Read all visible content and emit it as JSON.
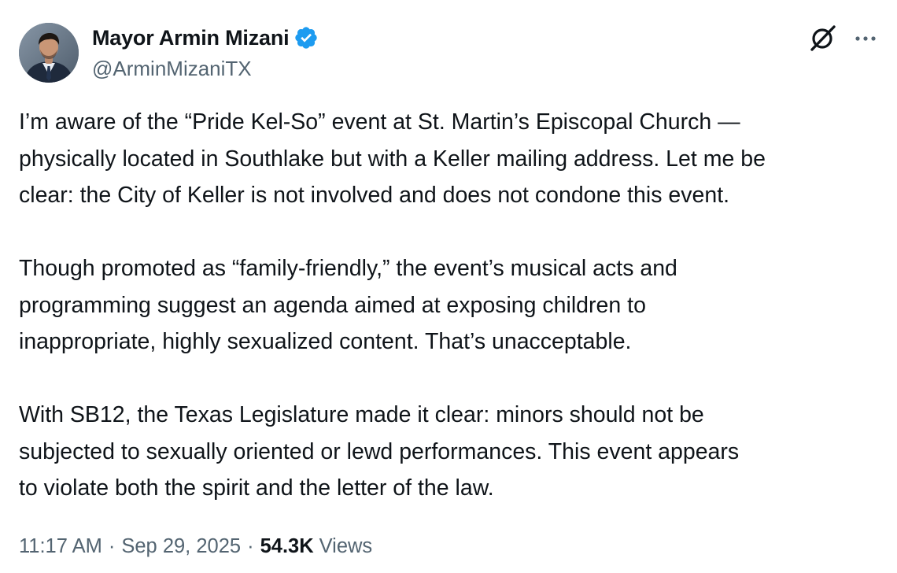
{
  "author": {
    "display_name": "Mayor Armin Mizani",
    "handle": "@ArminMizaniTX",
    "verified": true,
    "verified_color": "#1d9bf0",
    "avatar_icon": "profile-photo"
  },
  "actions": {
    "grok_icon": "grok-icon",
    "more_icon": "more-icon"
  },
  "tweet": {
    "paragraphs": [
      "I’m aware of the “Pride Kel-So” event at St. Martin’s Episcopal Church —\nphysically located in Southlake but with a Keller mailing address. Let me be\nclear: the City of Keller is not involved and does not condone this event.",
      "Though promoted as “family-friendly,” the event’s musical acts and\nprogramming suggest an agenda aimed at exposing children to\ninappropriate, highly sexualized content. That’s unacceptable.",
      "With SB12, the Texas Legislature made it clear: minors should not be\nsubjected to sexually oriented or lewd performances. This event appears\nto violate both the spirit and the letter of the law."
    ]
  },
  "meta": {
    "time": "11:17 AM",
    "separator": "·",
    "date": "Sep 29, 2025",
    "views_count": "54.3K",
    "views_label": "Views"
  },
  "colors": {
    "text_primary": "#0f1419",
    "text_secondary": "#536471",
    "background": "#ffffff"
  }
}
